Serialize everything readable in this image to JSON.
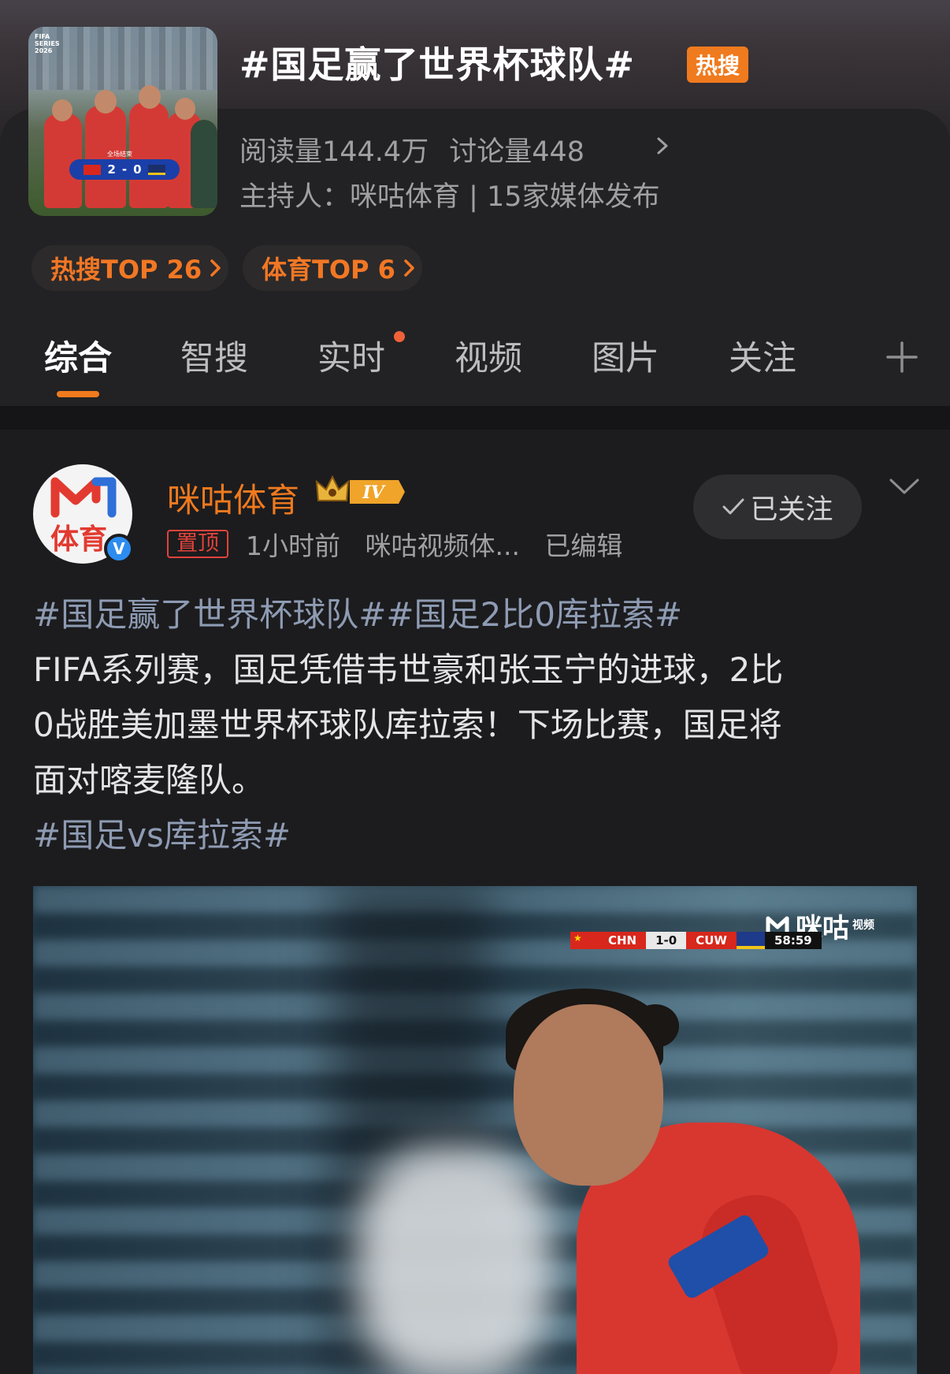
{
  "topic": {
    "title": "#国足赢了世界杯球队#",
    "hot_badge": "热搜",
    "reads_label": "阅读量144.4万",
    "discuss_label": "讨论量448",
    "host_label": "主持人：咪咕体育 | 15家媒体发布",
    "thumbnail": {
      "corner_text": "FIFA SERIES 2026",
      "score_caption": "全场结束",
      "home_score": "2",
      "away_score": "0"
    }
  },
  "rank_pills": [
    {
      "label": "热搜TOP 26"
    },
    {
      "label": "体育TOP 6"
    }
  ],
  "tabs": [
    {
      "label": "综合",
      "active": true
    },
    {
      "label": "智搜"
    },
    {
      "label": "实时",
      "has_dot": true
    },
    {
      "label": "视频"
    },
    {
      "label": "图片"
    },
    {
      "label": "关注"
    }
  ],
  "post": {
    "author": "咪咕体育",
    "avatar_text": "体育",
    "verified_badge": "V",
    "level_badge": "IV",
    "pinned": "置顶",
    "meta": "1小时前   咪咕视频体...   已编辑",
    "follow_label": "已关注",
    "text": {
      "tags_line": "#国足赢了世界杯球队##国足2比0库拉索#",
      "line1": "FIFA系列赛，国足凭借韦世豪和张玉宁的进球，2比",
      "line2": "0战胜美加墨世界杯球队库拉索！下场比赛，国足将",
      "line3": "面对喀麦隆队。",
      "tag_last": "#国足vs库拉索#"
    },
    "video": {
      "watermark": "咪咕",
      "watermark_sub": "视频",
      "home_team": "CHN",
      "score": "1-0",
      "away_team": "CUW",
      "clock": "58:59"
    }
  },
  "colors": {
    "accent": "#f07a1e",
    "tag": "#8e9bb3",
    "background": "#1c1c1e"
  }
}
